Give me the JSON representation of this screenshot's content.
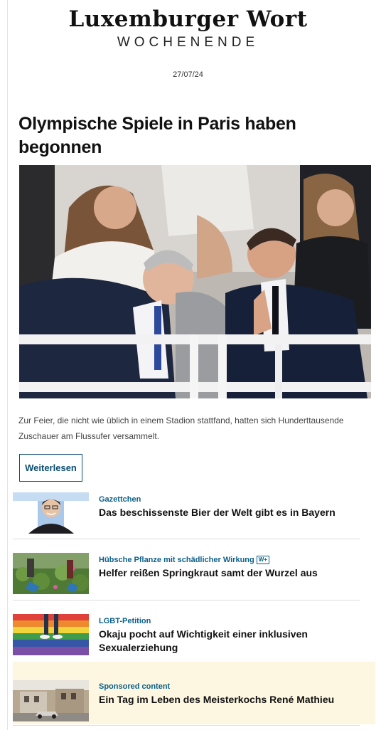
{
  "masthead": {
    "brand": "Luxemburger Wort",
    "edition": "WOCHENENDE",
    "date": "27/07/24"
  },
  "lead": {
    "headline": "Olympische Spiele in Paris haben begonnen",
    "teaser": "Zur Feier, die nicht wie üblich in einem Stadion stattfand, hatten sich Hunderttausende Zuschauer am Flussufer versammelt.",
    "read_more": "Weiterlesen"
  },
  "articles": [
    {
      "kicker": "Gazettchen",
      "title": "Das beschissenste Bier der Welt gibt es in Bayern",
      "badge": ""
    },
    {
      "kicker": "Hübsche Pflanze mit schädlicher Wirkung",
      "title": "Helfer reißen Springkraut samt der Wurzel aus",
      "badge": "W+"
    },
    {
      "kicker": "LGBT-Petition",
      "title": "Okaju pocht auf Wichtigkeit einer inklusiven Sexualerziehung",
      "badge": ""
    },
    {
      "kicker": "Sponsored content",
      "title": "Ein Tag im Leben des Meisterkochs René Mathieu",
      "badge": ""
    }
  ],
  "colors": {
    "accent": "#0b4d6f",
    "kicker": "#0b5f8a",
    "sponsored_bg": "#fdf7e1"
  }
}
